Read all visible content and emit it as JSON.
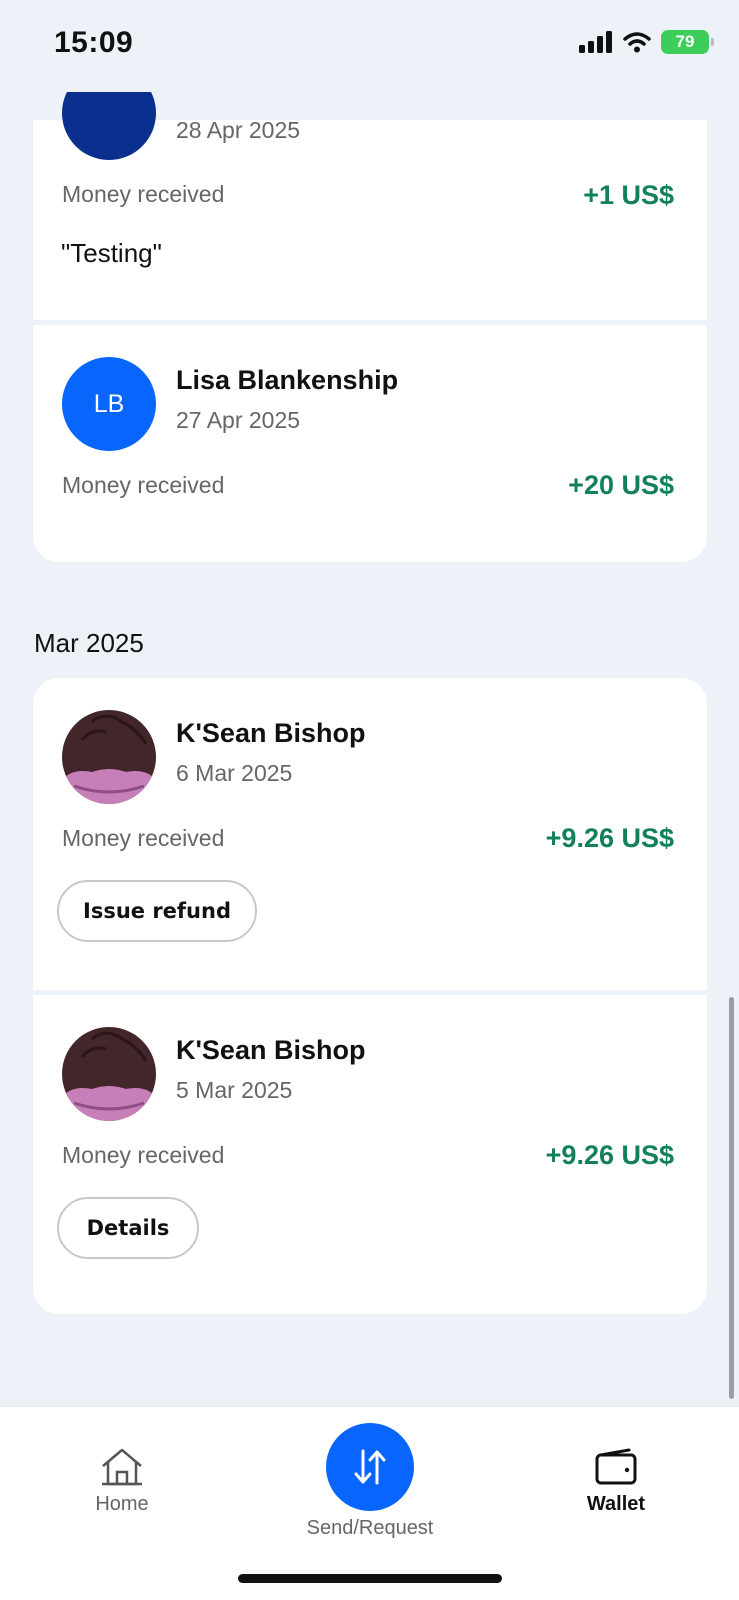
{
  "status_bar": {
    "time": "15:09",
    "battery": "79"
  },
  "transactions_top": [
    {
      "date": "28 Apr 2025",
      "label": "Money received",
      "amount": "+1 US$",
      "note": "\"Testing\""
    },
    {
      "initials": "LB",
      "name": "Lisa Blankenship",
      "date": "27 Apr 2025",
      "label": "Money received",
      "amount": "+20 US$"
    }
  ],
  "section": {
    "title": "Mar 2025"
  },
  "transactions_mar": [
    {
      "name": "K'Sean Bishop",
      "date": "6 Mar 2025",
      "label": "Money received",
      "amount": "+9.26 US$",
      "action": "Issue refund"
    },
    {
      "name": "K'Sean Bishop",
      "date": "5 Mar 2025",
      "label": "Money received",
      "amount": "+9.26 US$",
      "action": "Details"
    }
  ],
  "nav": {
    "home": "Home",
    "send_request": "Send/Request",
    "wallet": "Wallet"
  },
  "colors": {
    "accent_blue": "#0866ff",
    "positive_green": "#12805c",
    "avatar_dark_blue": "#0b2f8f"
  }
}
